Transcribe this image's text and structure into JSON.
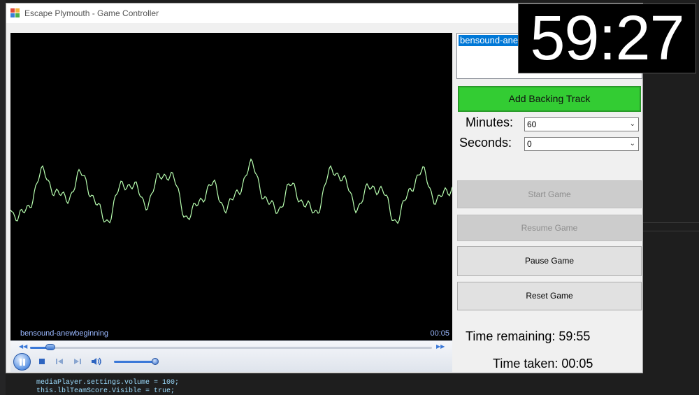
{
  "window": {
    "title": "Escape Plymouth - Game Controller"
  },
  "player": {
    "track_name": "bensound-anewbeginning",
    "current_time": "00:05",
    "seek_progress": 0.05,
    "volume": 1.0,
    "state": "playing"
  },
  "playlist": {
    "items": [
      "bensound-anewbeginning"
    ]
  },
  "buttons": {
    "add_backing_track": "Add Backing Track",
    "start_game": "Start Game",
    "resume_game": "Resume Game",
    "pause_game": "Pause Game",
    "reset_game": "Reset Game"
  },
  "settings": {
    "minutes_label": "Minutes:",
    "minutes_value": "60",
    "seconds_label": "Seconds:",
    "seconds_value": "0"
  },
  "status": {
    "time_remaining": "Time remaining: 59:55",
    "time_taken": "Time taken: 00:05"
  },
  "countdown": {
    "display": "59:27"
  },
  "background_code": [
    "mediaPlayer.settings.volume = 100;",
    "this.lblTeamScore.Visible = true;"
  ],
  "colors": {
    "add_button": "#33cc33",
    "waveform": "#b8ffb0",
    "selection": "#0078d7",
    "timer_bg": "#000000"
  }
}
